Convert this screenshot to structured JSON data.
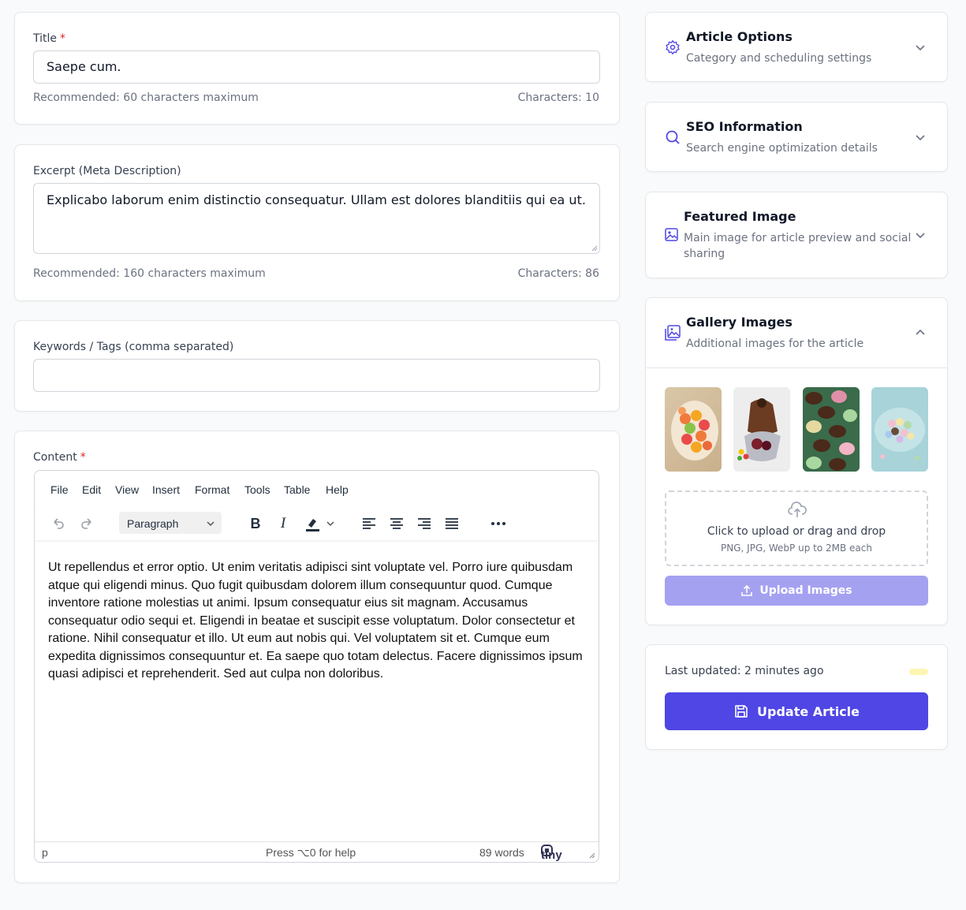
{
  "title_field": {
    "label": "Title",
    "required_mark": "*",
    "value": "Saepe cum.",
    "hint": "Recommended: 60 characters maximum",
    "count": "Characters: 10"
  },
  "excerpt_field": {
    "label": "Excerpt (Meta Description)",
    "value": "Explicabo laborum enim distinctio consequatur. Ullam est dolores blanditiis qui ea ut.",
    "hint": "Recommended: 160 characters maximum",
    "count": "Characters: 86"
  },
  "keywords_field": {
    "label": "Keywords / Tags (comma separated)",
    "value": ""
  },
  "content_field": {
    "label": "Content",
    "required_mark": "*",
    "menu": [
      "File",
      "Edit",
      "View",
      "Insert",
      "Format",
      "Tools",
      "Table",
      "Help"
    ],
    "block_format": "Paragraph",
    "body": "Ut repellendus et error optio. Ut enim veritatis adipisci sint voluptate vel. Porro iure quibusdam atque qui eligendi minus. Quo fugit quibusdam dolorem illum consequuntur quod. Cumque inventore ratione molestias ut animi. Ipsum consequatur eius sit magnam. Accusamus consequatur odio sequi et. Eligendi in beatae et suscipit esse voluptatum. Dolor consectetur et ratione. Nihil consequatur et illo. Ut eum aut nobis qui. Vel voluptatem sit et. Cumque eum expedita dignissimos consequuntur et. Ea saepe quo totam delectus. Facere dignissimos ipsum quasi adipisci et reprehenderit. Sed aut culpa non doloribus.",
    "status_path": "p",
    "status_help": "Press ⌥0 for help",
    "status_words": "89 words",
    "brand": "tiny"
  },
  "sidebar": {
    "article_options": {
      "title": "Article Options",
      "subtitle": "Category and scheduling settings",
      "icon": "gear-icon"
    },
    "seo": {
      "title": "SEO Information",
      "subtitle": "Search engine optimization details",
      "icon": "search-icon"
    },
    "featured_image": {
      "title": "Featured Image",
      "subtitle": "Main image for article preview and social sharing",
      "icon": "image-icon"
    },
    "gallery": {
      "title": "Gallery Images",
      "subtitle": "Additional images for the article",
      "icon": "images-icon",
      "dropzone_title": "Click to upload or drag and drop",
      "dropzone_hint": "PNG, JPG, WebP up to 2MB each",
      "upload_label": "Upload Images"
    },
    "publish": {
      "last_updated": "Last updated: 2 minutes ago",
      "update_label": "Update Article"
    }
  },
  "colors": {
    "accent": "#4f46e5",
    "accent_disabled": "#a5a1f1",
    "required": "#dc2626"
  }
}
